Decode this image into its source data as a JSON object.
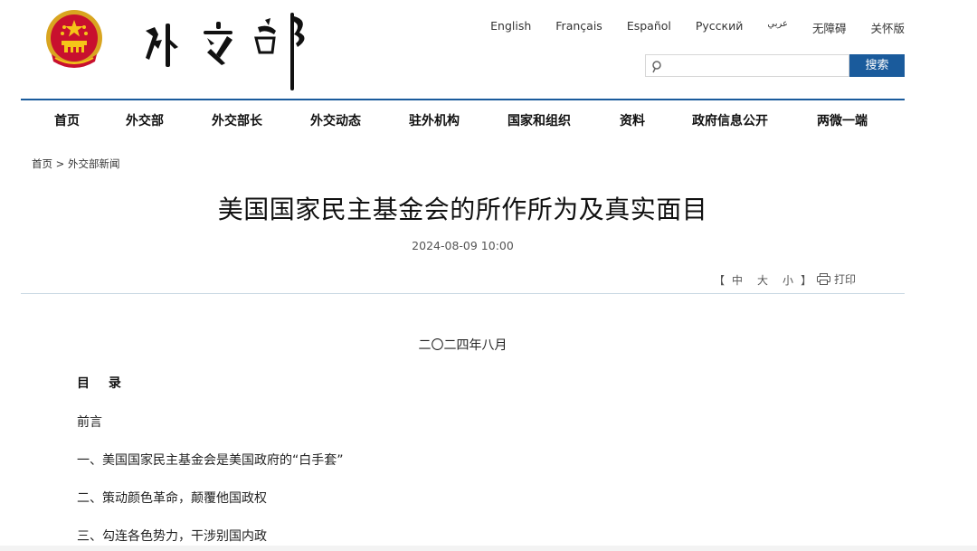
{
  "header": {
    "logo_text": "外交部",
    "languages": [
      "English",
      "Français",
      "Español",
      "Русский",
      "عربي",
      "无障碍",
      "关怀版"
    ],
    "search": {
      "placeholder": "",
      "button_label": "搜索"
    }
  },
  "nav": {
    "items": [
      "首页",
      "外交部",
      "外交部长",
      "外交动态",
      "驻外机构",
      "国家和组织",
      "资料",
      "政府信息公开",
      "两微一端"
    ]
  },
  "breadcrumb": {
    "home": "首页",
    "separator": ">",
    "current": "外交部新闻"
  },
  "article": {
    "title": "美国国家民主基金会的所作所为及真实面目",
    "date": "2024-08-09 10:00",
    "font_size": {
      "open": "【",
      "medium": "中",
      "large": "大",
      "small": "小",
      "close": "】"
    },
    "print_label": "打印",
    "date_line": "二〇二四年八月",
    "toc_heading": "目 录",
    "toc_items": [
      "前言",
      "一、美国国家民主基金会是美国政府的“白手套”",
      "二、策动颜色革命，颠覆他国政权",
      "三、勾连各色势力，干涉别国内政"
    ]
  },
  "colors": {
    "accent": "#1a5b9c",
    "divider": "#c7d7e2"
  }
}
